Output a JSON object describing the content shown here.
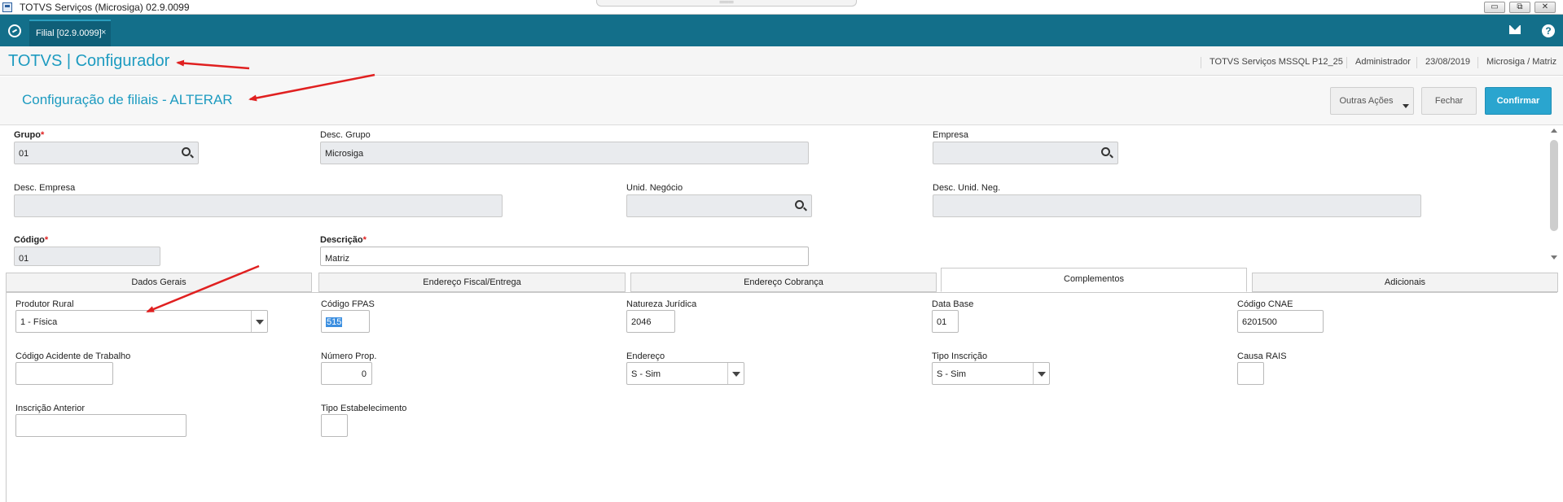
{
  "window": {
    "title": "TOTVS Serviços (Microsiga) 02.9.0099",
    "grip": "═══",
    "minimize": "▭",
    "maximize": "⧉",
    "close": "✕"
  },
  "tabstrip": {
    "tab_label": "Filial [02.9.0099]",
    "tab_close": "×",
    "help": "?"
  },
  "header": {
    "brand": "TOTVS | Configurador",
    "environment": "TOTVS Serviços MSSQL P12_25",
    "user": "Administrador",
    "date": "23/08/2019",
    "branch": "Microsiga / Matriz"
  },
  "page": {
    "title": "Configuração de filiais - ALTERAR",
    "buttons": {
      "other_actions": "Outras Ações",
      "close": "Fechar",
      "confirm": "Confirmar"
    }
  },
  "form": {
    "grupo": {
      "label": "Grupo",
      "required": "*",
      "value": "01"
    },
    "desc_grupo": {
      "label": "Desc. Grupo",
      "value": "Microsiga"
    },
    "empresa": {
      "label": "Empresa",
      "value": ""
    },
    "desc_empresa": {
      "label": "Desc. Empresa",
      "value": ""
    },
    "unid_negocio": {
      "label": "Unid. Negócio",
      "value": ""
    },
    "desc_unid_neg": {
      "label": "Desc. Unid. Neg.",
      "value": ""
    },
    "codigo": {
      "label": "Código",
      "required": "*",
      "value": "01"
    },
    "descricao": {
      "label": "Descrição",
      "required": "*",
      "value": "Matriz"
    }
  },
  "folder_tabs": [
    "Dados Gerais",
    "Endereço Fiscal/Entrega",
    "Endereço Cobrança",
    "Complementos",
    "Adicionais"
  ],
  "active_tab": "Complementos",
  "complementos": {
    "produtor_rural": {
      "label": "Produtor Rural",
      "value": "1 - Física"
    },
    "codigo_fpas": {
      "label": "Código FPAS",
      "value": "515"
    },
    "natureza_juridica": {
      "label": "Natureza Jurídica",
      "value": "2046"
    },
    "data_base": {
      "label": "Data Base",
      "value": "01"
    },
    "codigo_cnae": {
      "label": "Código CNAE",
      "value": "6201500"
    },
    "codigo_acidente": {
      "label": "Código Acidente de Trabalho",
      "value": ""
    },
    "numero_prop": {
      "label": "Número Prop.",
      "value": "0"
    },
    "endereco": {
      "label": "Endereço",
      "value": "S - Sim"
    },
    "tipo_inscricao": {
      "label": "Tipo Inscrição",
      "value": "S - Sim"
    },
    "causa_rais": {
      "label": "Causa RAIS",
      "value": ""
    },
    "inscricao_anterior": {
      "label": "Inscrição Anterior",
      "value": ""
    },
    "tipo_estabelecimento": {
      "label": "Tipo Estabelecimento",
      "value": ""
    }
  },
  "colors": {
    "tabstrip": "#136f8a",
    "brand": "#1d9bc0",
    "confirm": "#2aa5cf",
    "annotation_arrow": "#e02020"
  }
}
